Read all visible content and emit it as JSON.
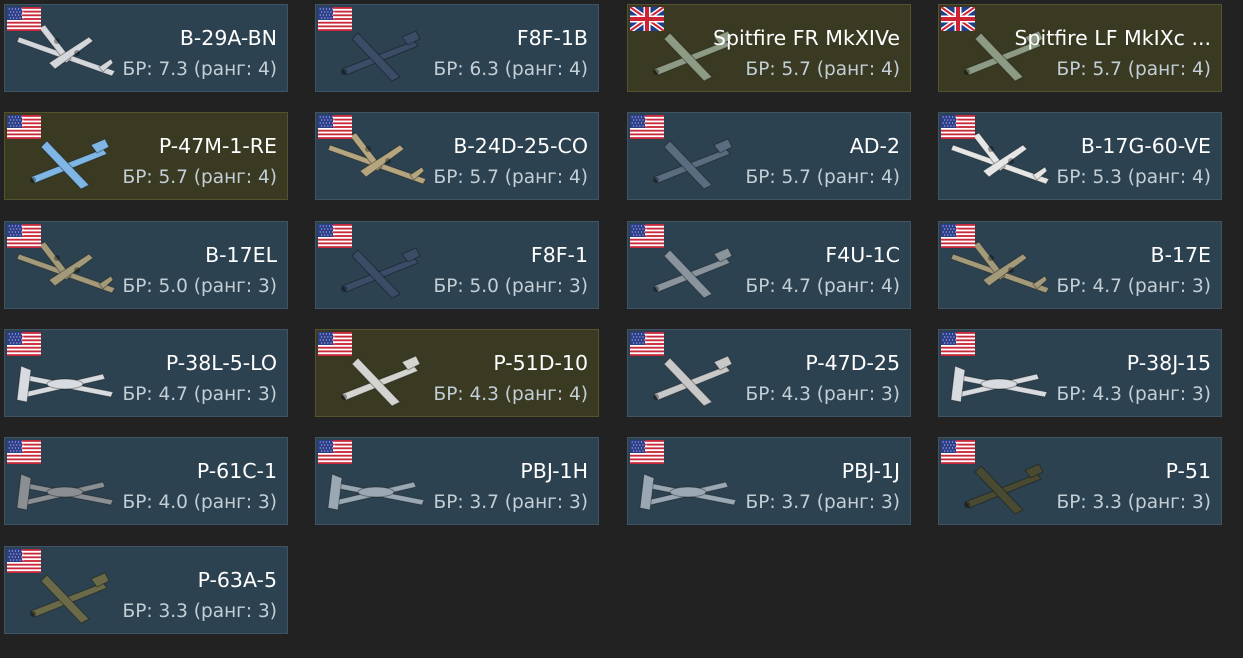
{
  "vehicles": [
    {
      "name": "B-29A-BN",
      "br": "БР: 7.3 (ранг: 4)",
      "flag": "usa-flag-icon",
      "premium": false,
      "plane_color": "#d4d8dc",
      "plane_shape": "bomber4"
    },
    {
      "name": "F8F-1B",
      "br": "БР: 6.3 (ранг: 4)",
      "flag": "usa-flag-icon",
      "premium": false,
      "plane_color": "#3b4c66",
      "plane_shape": "fighter"
    },
    {
      "name": "Spitfire FR MkXIVe",
      "br": "БР: 5.7 (ранг: 4)",
      "flag": "uk-flag-icon",
      "premium": true,
      "plane_color": "#8d9a84",
      "plane_shape": "fighter"
    },
    {
      "name": "Spitfire LF MkIXc ...",
      "br": "БР: 5.7 (ранг: 4)",
      "flag": "uk-flag-icon",
      "premium": true,
      "plane_color": "#8d9a84",
      "plane_shape": "fighter"
    },
    {
      "name": "P-47M-1-RE",
      "br": "БР: 5.7 (ранг: 4)",
      "flag": "usa-flag-icon",
      "premium": true,
      "plane_color": "#7fb6e6",
      "plane_shape": "fighter"
    },
    {
      "name": "B-24D-25-CO",
      "br": "БР: 5.7 (ранг: 4)",
      "flag": "usa-flag-icon",
      "premium": false,
      "plane_color": "#b5a680",
      "plane_shape": "bomber4"
    },
    {
      "name": "AD-2",
      "br": "БР: 5.7 (ранг: 4)",
      "flag": "usa-flag-icon",
      "premium": false,
      "plane_color": "#5a6c80",
      "plane_shape": "fighter"
    },
    {
      "name": "B-17G-60-VE",
      "br": "БР: 5.3 (ранг: 4)",
      "flag": "usa-flag-icon",
      "premium": false,
      "plane_color": "#e6e6e6",
      "plane_shape": "bomber4"
    },
    {
      "name": "B-17EL",
      "br": "БР: 5.0 (ранг: 3)",
      "flag": "usa-flag-icon",
      "premium": false,
      "plane_color": "#a39a7a",
      "plane_shape": "bomber4"
    },
    {
      "name": "F8F-1",
      "br": "БР: 5.0 (ранг: 3)",
      "flag": "usa-flag-icon",
      "premium": false,
      "plane_color": "#3b4c66",
      "plane_shape": "fighter"
    },
    {
      "name": "F4U-1C",
      "br": "БР: 4.7 (ранг: 4)",
      "flag": "usa-flag-icon",
      "premium": false,
      "plane_color": "#8a949c",
      "plane_shape": "fighter"
    },
    {
      "name": "B-17E",
      "br": "БР: 4.7 (ранг: 3)",
      "flag": "usa-flag-icon",
      "premium": false,
      "plane_color": "#a39a7a",
      "plane_shape": "bomber4"
    },
    {
      "name": "P-38L-5-LO",
      "br": "БР: 4.7 (ранг: 3)",
      "flag": "usa-flag-icon",
      "premium": false,
      "plane_color": "#d8dce0",
      "plane_shape": "twin"
    },
    {
      "name": "P-51D-10",
      "br": "БР: 4.3 (ранг: 4)",
      "flag": "usa-flag-icon",
      "premium": true,
      "plane_color": "#d4d4d0",
      "plane_shape": "fighter"
    },
    {
      "name": "P-47D-25",
      "br": "БР: 4.3 (ранг: 3)",
      "flag": "usa-flag-icon",
      "premium": false,
      "plane_color": "#c8c8c8",
      "plane_shape": "fighter"
    },
    {
      "name": "P-38J-15",
      "br": "БР: 4.3 (ранг: 3)",
      "flag": "usa-flag-icon",
      "premium": false,
      "plane_color": "#d8dce0",
      "plane_shape": "twin"
    },
    {
      "name": "P-61C-1",
      "br": "БР: 4.0 (ранг: 3)",
      "flag": "usa-flag-icon",
      "premium": false,
      "plane_color": "#8a8f94",
      "plane_shape": "twin"
    },
    {
      "name": "PBJ-1H",
      "br": "БР: 3.7 (ранг: 3)",
      "flag": "usa-flag-icon",
      "premium": false,
      "plane_color": "#9aa8b4",
      "plane_shape": "twin"
    },
    {
      "name": "PBJ-1J",
      "br": "БР: 3.7 (ранг: 3)",
      "flag": "usa-flag-icon",
      "premium": false,
      "plane_color": "#9aa8b4",
      "plane_shape": "twin"
    },
    {
      "name": "P-51",
      "br": "БР: 3.3 (ранг: 3)",
      "flag": "usa-flag-icon",
      "premium": false,
      "plane_color": "#4a4a32",
      "plane_shape": "fighter"
    },
    {
      "name": "P-63A-5",
      "br": "БР: 3.3 (ранг: 3)",
      "flag": "usa-flag-icon",
      "premium": false,
      "plane_color": "#6b6a48",
      "plane_shape": "fighter"
    }
  ]
}
